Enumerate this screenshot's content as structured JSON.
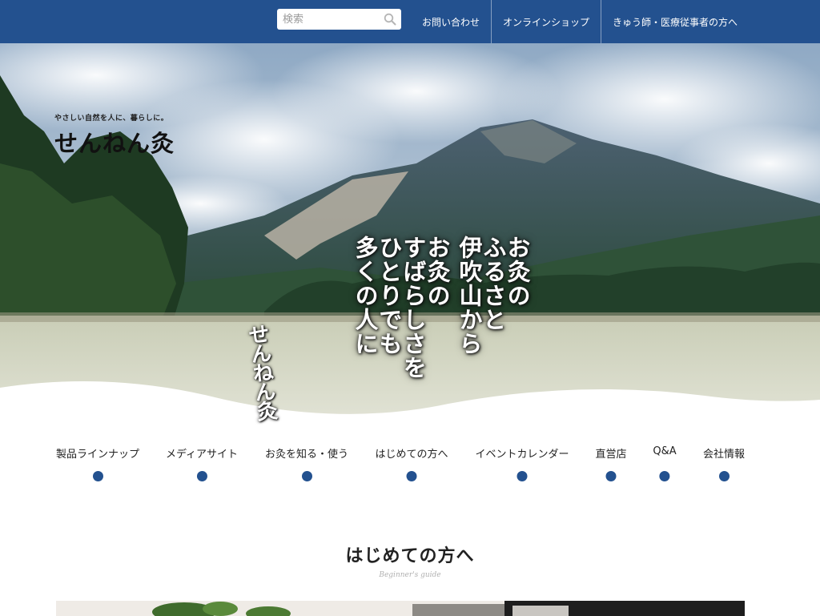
{
  "search": {
    "placeholder": "検索",
    "icon": "search-icon"
  },
  "top_links": [
    {
      "label": "お問い合わせ"
    },
    {
      "label": "オンラインショップ"
    },
    {
      "label": "きゅう師・医療従事者の方へ"
    }
  ],
  "logo": {
    "tagline": "やさしい自然を人に、暮らしに。",
    "name": "せんねん灸"
  },
  "hero": {
    "vertical_lines": [
      "お灸の",
      "ふるさと",
      "伊吹山から",
      "お灸の",
      "すばらしさを",
      "ひとりでも",
      "多くの人に"
    ],
    "brand_mark": "せんねん灸"
  },
  "nav": [
    {
      "label": "製品ラインナップ"
    },
    {
      "label": "メディアサイト"
    },
    {
      "label": "お灸を知る・使う"
    },
    {
      "label": "はじめての方へ"
    },
    {
      "label": "イベントカレンダー"
    },
    {
      "label": "直営店"
    },
    {
      "label": "Q&A"
    },
    {
      "label": "会社情報"
    }
  ],
  "section": {
    "title": "はじめての方へ",
    "subtitle": "Beginner's guide"
  },
  "colors": {
    "brand_blue": "#23518f",
    "white": "#ffffff"
  }
}
